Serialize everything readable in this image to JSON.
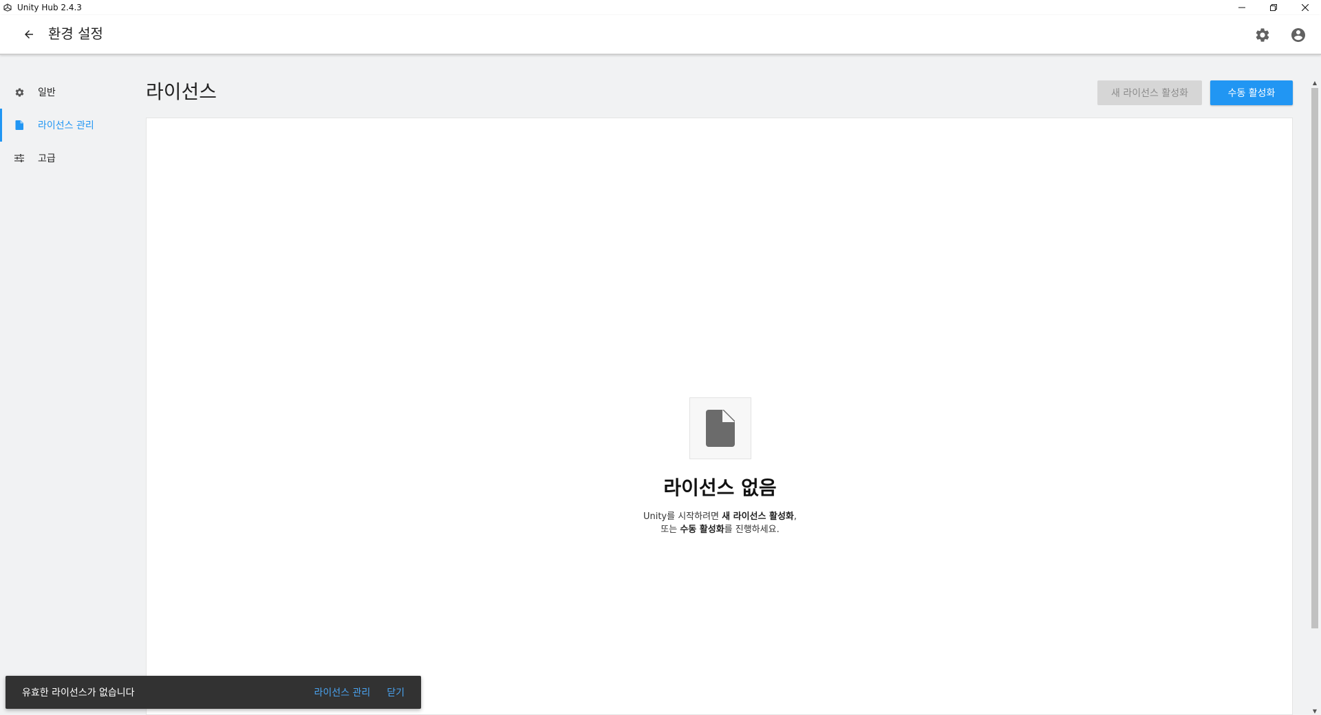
{
  "window": {
    "title": "Unity Hub 2.4.3",
    "app_icon": "unity-logo-icon",
    "controls": [
      "minimize-icon",
      "restore-icon",
      "close-icon"
    ]
  },
  "header": {
    "back_icon": "arrow-left-icon",
    "title": "환경 설정",
    "settings_icon": "gear-icon",
    "account_icon": "account-circle-icon"
  },
  "sidebar": {
    "items": [
      {
        "label": "일반",
        "icon": "gear-icon",
        "active": false
      },
      {
        "label": "라이선스 관리",
        "icon": "file-icon",
        "active": true
      },
      {
        "label": "고급",
        "icon": "sliders-icon",
        "active": false
      }
    ]
  },
  "main": {
    "title": "라이선스",
    "new_license_button": "새 라이선스 활성화",
    "manual_activation_button": "수동 활성화",
    "empty_state": {
      "icon": "file-icon",
      "title": "라이선스 없음",
      "desc_line1_a": "Unity를 시작하려면 ",
      "desc_line1_b": "새 라이선스 활성화",
      "desc_line1_c": ",",
      "desc_line2_a": "또는 ",
      "desc_line2_b": "수동 활성화",
      "desc_line2_c": "를 진행하세요."
    }
  },
  "snackbar": {
    "message": "유효한 라이선스가 없습니다",
    "action_manage": "라이선스 관리",
    "action_close": "닫기"
  },
  "colors": {
    "accent": "#2196f3",
    "background": "#f1f2f3",
    "snackbar": "#323232",
    "disabled_button": "#d6d6d6"
  }
}
